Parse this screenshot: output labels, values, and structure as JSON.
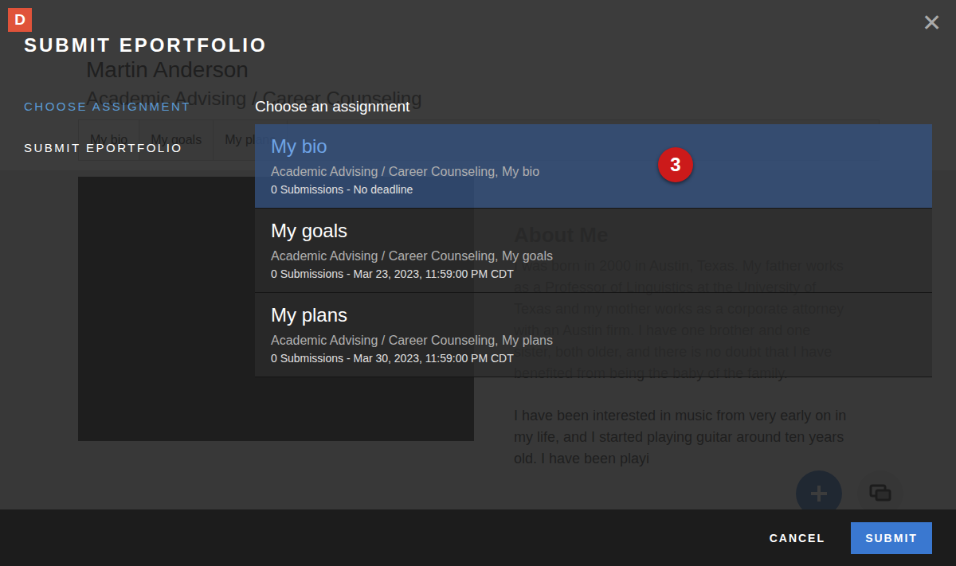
{
  "app_badge": "D",
  "page": {
    "name": "Martin Anderson",
    "subtitle": "Academic Advising / Career Counseling",
    "tabs": [
      {
        "label": "My bio",
        "selected": true
      },
      {
        "label": "My goals",
        "selected": false
      },
      {
        "label": "My plans",
        "selected": false
      }
    ],
    "heading": "About Me",
    "paragraphs": [
      "I was born in 2000 in Austin, Texas. My father works as a Professor of Linguistics at the University of Texas and my mother works as a corporate attorney with an Austin firm. I have one brother and one sister, both older, and there is no doubt that I have benefited from being the baby of the family.",
      "I have been interested in music from very early on in my life, and I started playing guitar around ten years old. I have been playi"
    ]
  },
  "dialog": {
    "title": "SUBMIT EPORTFOLIO",
    "close": "✕",
    "steps": [
      {
        "label": "CHOOSE ASSIGNMENT",
        "selected": true
      },
      {
        "label": "SUBMIT EPORTFOLIO",
        "selected": false
      }
    ],
    "prompt": "Choose an assignment",
    "assignments": [
      {
        "title": "My bio",
        "path": "Academic Advising / Career Counseling, My bio",
        "meta": "0 Submissions - No deadline",
        "selected": true
      },
      {
        "title": "My goals",
        "path": "Academic Advising / Career Counseling, My goals",
        "meta": "0 Submissions - Mar 23, 2023, 11:59:00 PM CDT",
        "selected": false
      },
      {
        "title": "My plans",
        "path": "Academic Advising / Career Counseling, My plans",
        "meta": "0 Submissions - Mar 30, 2023, 11:59:00 PM CDT",
        "selected": false
      }
    ],
    "callout": "3",
    "buttons": {
      "cancel": "CANCEL",
      "submit": "SUBMIT"
    }
  }
}
